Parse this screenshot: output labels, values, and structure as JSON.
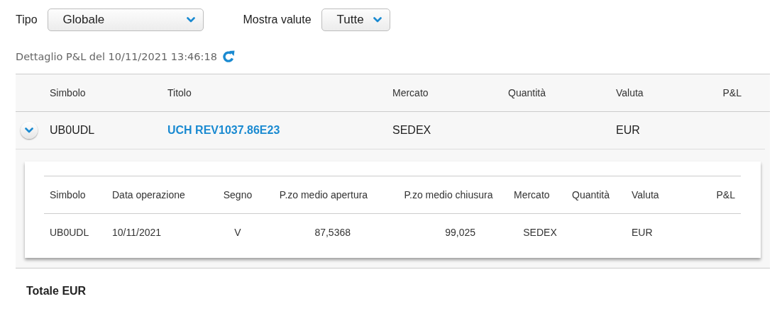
{
  "filters": [
    {
      "label": "Tipo",
      "value": "Globale"
    },
    {
      "label": "Mostra valute",
      "value": "Tutte"
    }
  ],
  "timestamp": "Dettaglio P&L del 10/11/2021 13:46:18",
  "table": {
    "columns": [
      "Simbolo",
      "Titolo",
      "Mercato",
      "Quantità",
      "Valuta",
      "P&L"
    ],
    "rows": [
      {
        "expanded": true,
        "simbolo": "UB0UDL",
        "titolo": "UCH REV1037.86E23",
        "mercato": "SEDEX",
        "valuta": "EUR",
        "detail": {
          "columns": [
            "Simbolo",
            "Data operazione",
            "Segno",
            "P.zo medio apertura",
            "P.zo medio chiusura",
            "Mercato",
            "Quantità",
            "Valuta",
            "P&L"
          ],
          "rows": [
            [
              "UB0UDL",
              "10/11/2021",
              "V",
              "87,5368",
              "99,025",
              "SEDEX",
              "",
              "EUR",
              ""
            ]
          ]
        }
      }
    ]
  },
  "total": {
    "label": "Totale EUR"
  }
}
